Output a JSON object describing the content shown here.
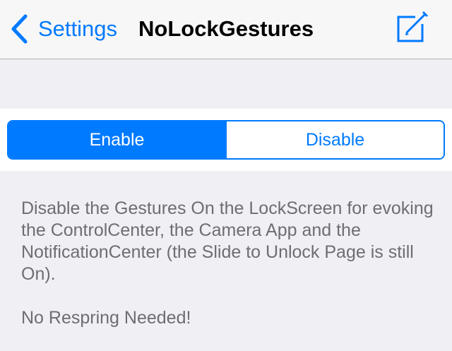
{
  "navbar": {
    "back_label": "Settings",
    "title": "NoLockGestures",
    "back_icon": "chevron-left-icon",
    "action_icon": "compose-icon"
  },
  "segmented_control": {
    "options": [
      {
        "label": "Enable",
        "selected": true
      },
      {
        "label": "Disable",
        "selected": false
      }
    ]
  },
  "footer": {
    "description": "Disable the Gestures On the LockScreen for evoking the ControlCenter, the Camera App and the NotificationCenter (the Slide to Unlock Page is still On).",
    "note": "No Respring Needed!"
  },
  "colors": {
    "accent": "#007aff",
    "background": "#efeff4",
    "footer_text": "#6d6d72"
  }
}
